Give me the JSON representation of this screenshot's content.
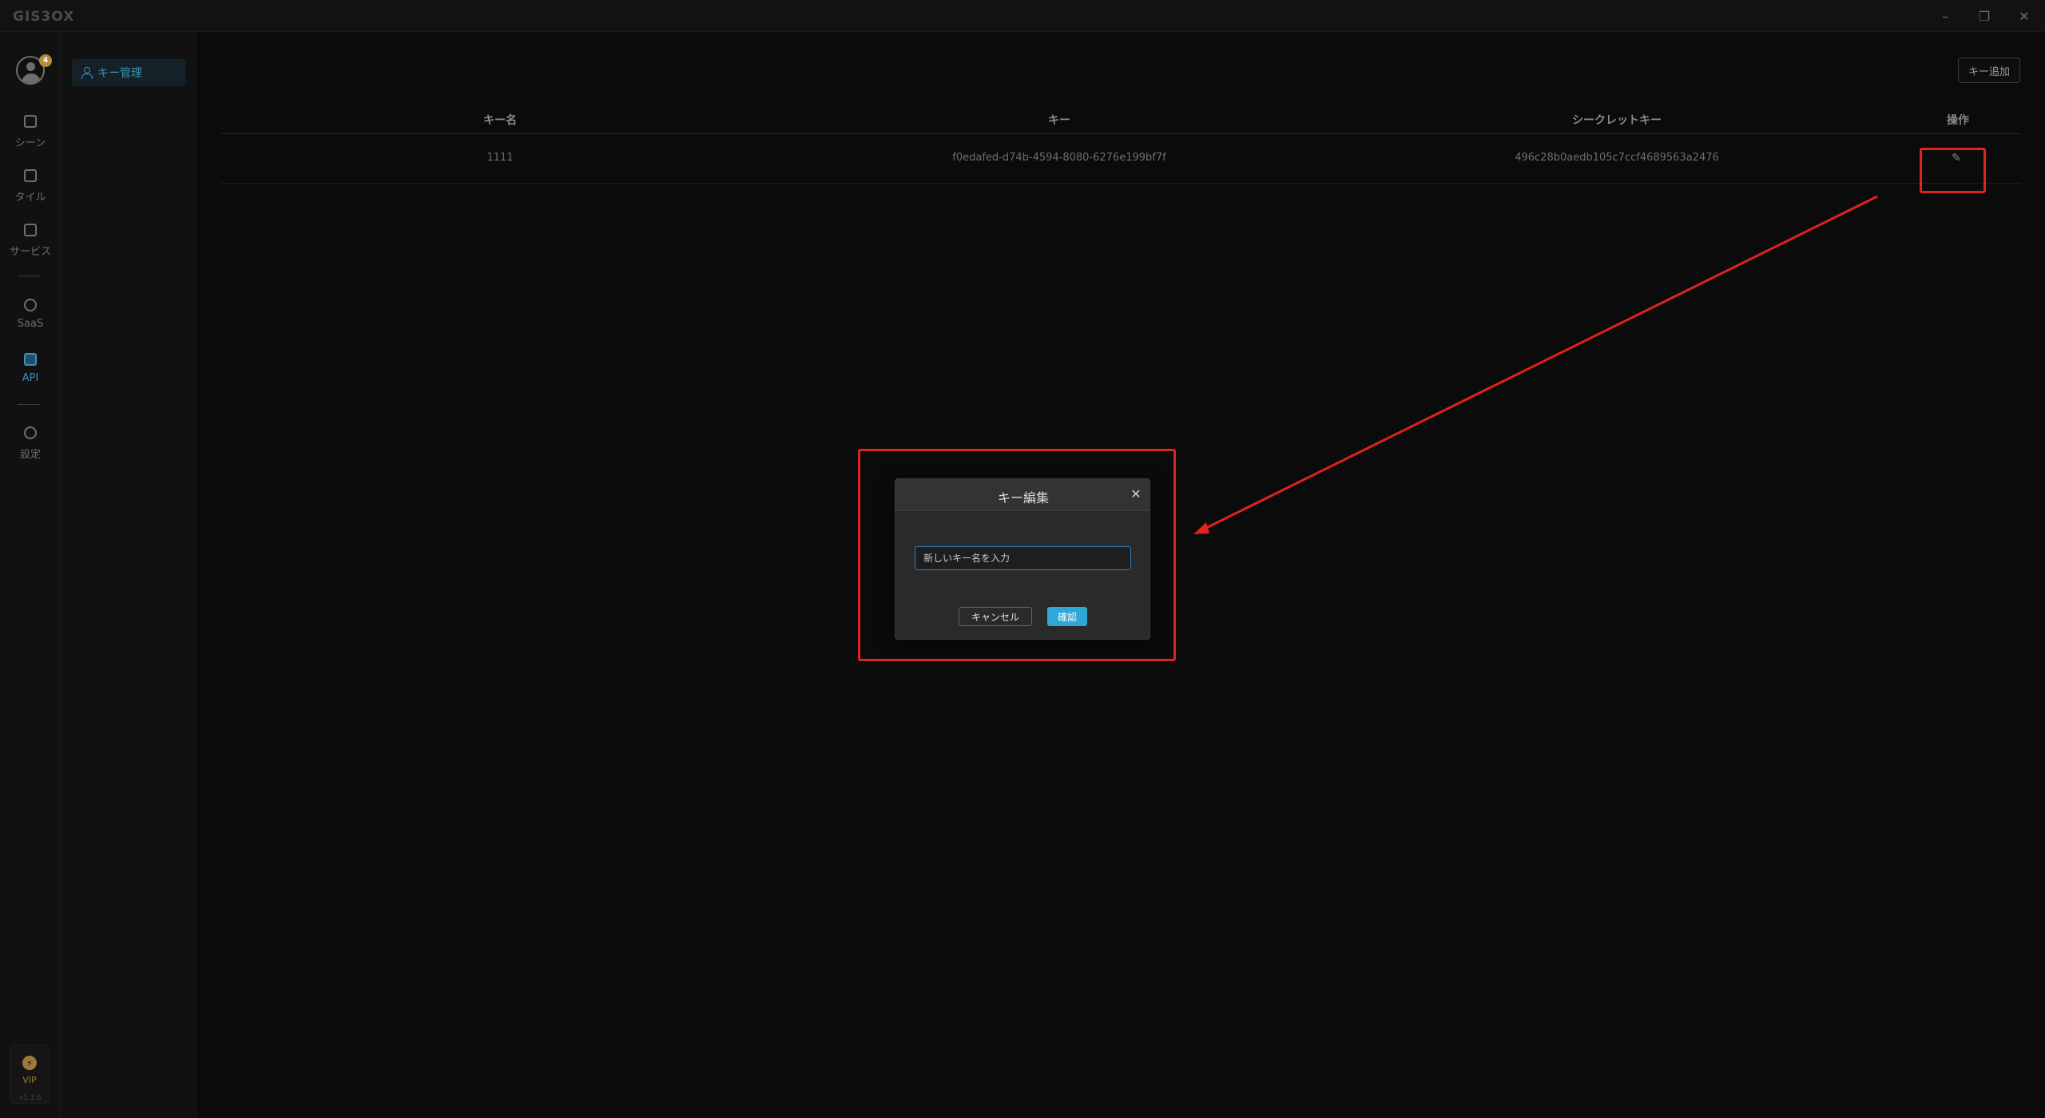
{
  "app": {
    "logo": "GIS3OX",
    "window_controls": {
      "minimize": "–",
      "maximize": "❐",
      "close": "✕"
    }
  },
  "user": {
    "badge": "4"
  },
  "rail": {
    "items": [
      {
        "label": "シーン",
        "icon": "scene-icon"
      },
      {
        "label": "タイル",
        "icon": "tile-icon"
      },
      {
        "label": "サービス",
        "icon": "service-icon"
      },
      {
        "label": "SaaS",
        "icon": "saas-icon"
      },
      {
        "label": "API",
        "icon": "api-icon",
        "active": true
      },
      {
        "label": "設定",
        "icon": "settings-icon"
      }
    ],
    "vip_label": "VIP",
    "version": "v1.1.6"
  },
  "subnav": {
    "items": [
      {
        "label": "キー管理",
        "icon": "user-icon"
      }
    ]
  },
  "main": {
    "add_button": "キー追加",
    "table": {
      "headers": [
        "キー名",
        "キー",
        "シークレットキー",
        "操作"
      ],
      "rows": [
        {
          "name": "1111",
          "key": "f0edafed-d74b-4594-8080-6276e199bf7f",
          "secret": "496c28b0aedb105c7ccf4689563a2476",
          "action_icon": "edit-icon"
        }
      ]
    }
  },
  "dialog": {
    "title": "キー編集",
    "input_placeholder": "新しいキー名を入力",
    "cancel_label": "キャンセル",
    "ok_label": "確認"
  },
  "colors": {
    "accent": "#3f8fb8",
    "annotation": "#e0231c",
    "confirm": "#2fa8d8"
  }
}
